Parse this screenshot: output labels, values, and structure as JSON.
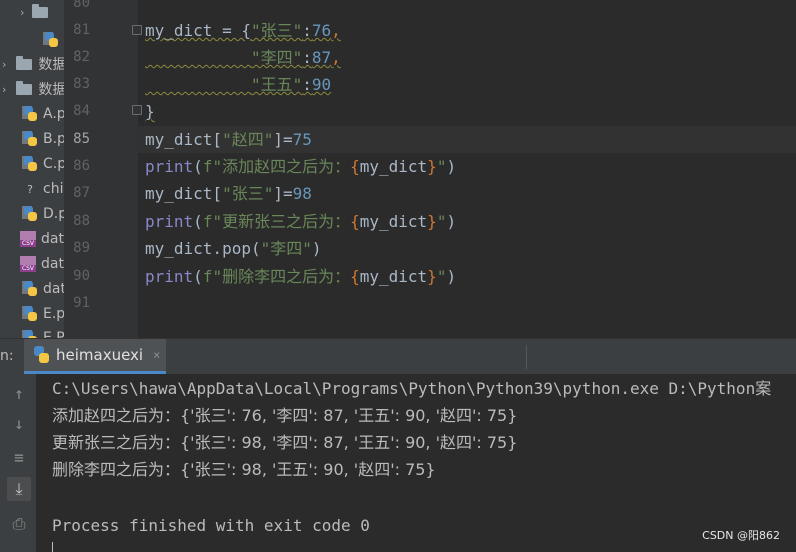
{
  "project_tree": {
    "items": [
      {
        "type": "folder",
        "label": ""
      },
      {
        "type": "py",
        "label": ""
      },
      {
        "type": "folder",
        "label": "数据"
      },
      {
        "type": "folder",
        "label": "数据"
      },
      {
        "type": "py",
        "label": "A.p"
      },
      {
        "type": "py",
        "label": "B.p"
      },
      {
        "type": "py",
        "label": "C.p"
      },
      {
        "type": "unknown",
        "label": "chi"
      },
      {
        "type": "py",
        "label": "D.p"
      },
      {
        "type": "csv",
        "label": "dat"
      },
      {
        "type": "csv",
        "label": "dat"
      },
      {
        "type": "py",
        "label": "dat"
      },
      {
        "type": "py",
        "label": "E.p"
      },
      {
        "type": "py",
        "label": "E.P"
      }
    ]
  },
  "editor": {
    "line_numbers": [
      "80",
      "81",
      "82",
      "83",
      "84",
      "85",
      "86",
      "87",
      "88",
      "89",
      "90",
      "91"
    ],
    "current_line": "85",
    "code_lines": [
      "my_dict = {\"张三\":76,",
      "           \"李四\":87,",
      "           \"王五\":90",
      "}",
      "my_dict[\"赵四\"]=75",
      "print(f\"添加赵四之后为：{my_dict}\")",
      "my_dict[\"张三\"]=98",
      "print(f\"更新张三之后为：{my_dict}\")",
      "my_dict.pop(\"李四\")",
      "print(f\"删除李四之后为：{my_dict}\")"
    ]
  },
  "run_panel": {
    "label": "n:",
    "tab_name": "heimaxuexi",
    "close_glyph": "×"
  },
  "toolbar": {
    "icons": [
      "arrow-up-icon",
      "arrow-down-icon",
      "soft-wrap-icon",
      "scroll-to-end-icon",
      "print-icon"
    ]
  },
  "console": {
    "lines": [
      "C:\\Users\\hawa\\AppData\\Local\\Programs\\Python\\Python39\\python.exe D:\\Python案",
      "添加赵四之后为：{'张三': 76, '李四': 87, '王五': 90, '赵四': 75}",
      "更新张三之后为：{'张三': 98, '李四': 87, '王五': 90, '赵四': 75}",
      "删除李四之后为：{'张三': 98, '王五': 90, '赵四': 75}",
      "",
      "Process finished with exit code 0"
    ]
  },
  "watermark": "CSDN @阳862",
  "colors": {
    "background": "#2b2b2b",
    "string": "#6a8759",
    "number": "#6897bb",
    "keyword": "#cc7832",
    "builtin": "#8888c6"
  }
}
